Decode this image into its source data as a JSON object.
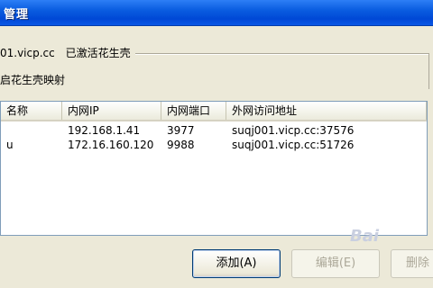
{
  "window": {
    "title": "管理"
  },
  "status": {
    "domain": "01.vicp.cc",
    "state": "已激活花生壳"
  },
  "enable": {
    "label": "启花生壳映射"
  },
  "table": {
    "columns": [
      "名称",
      "内网IP",
      "内网端口",
      "外网访问地址"
    ],
    "rows": [
      {
        "name": "",
        "ip": "192.168.1.41",
        "port": "3977",
        "external": "suqj001.vicp.cc:37576"
      },
      {
        "name": "u",
        "ip": "172.16.160.120",
        "port": "9988",
        "external": "suqj001.vicp.cc:51726"
      }
    ]
  },
  "buttons": {
    "add": "添加(A)",
    "edit": "编辑(E)",
    "delete": "删除"
  },
  "watermark": "Bai"
}
